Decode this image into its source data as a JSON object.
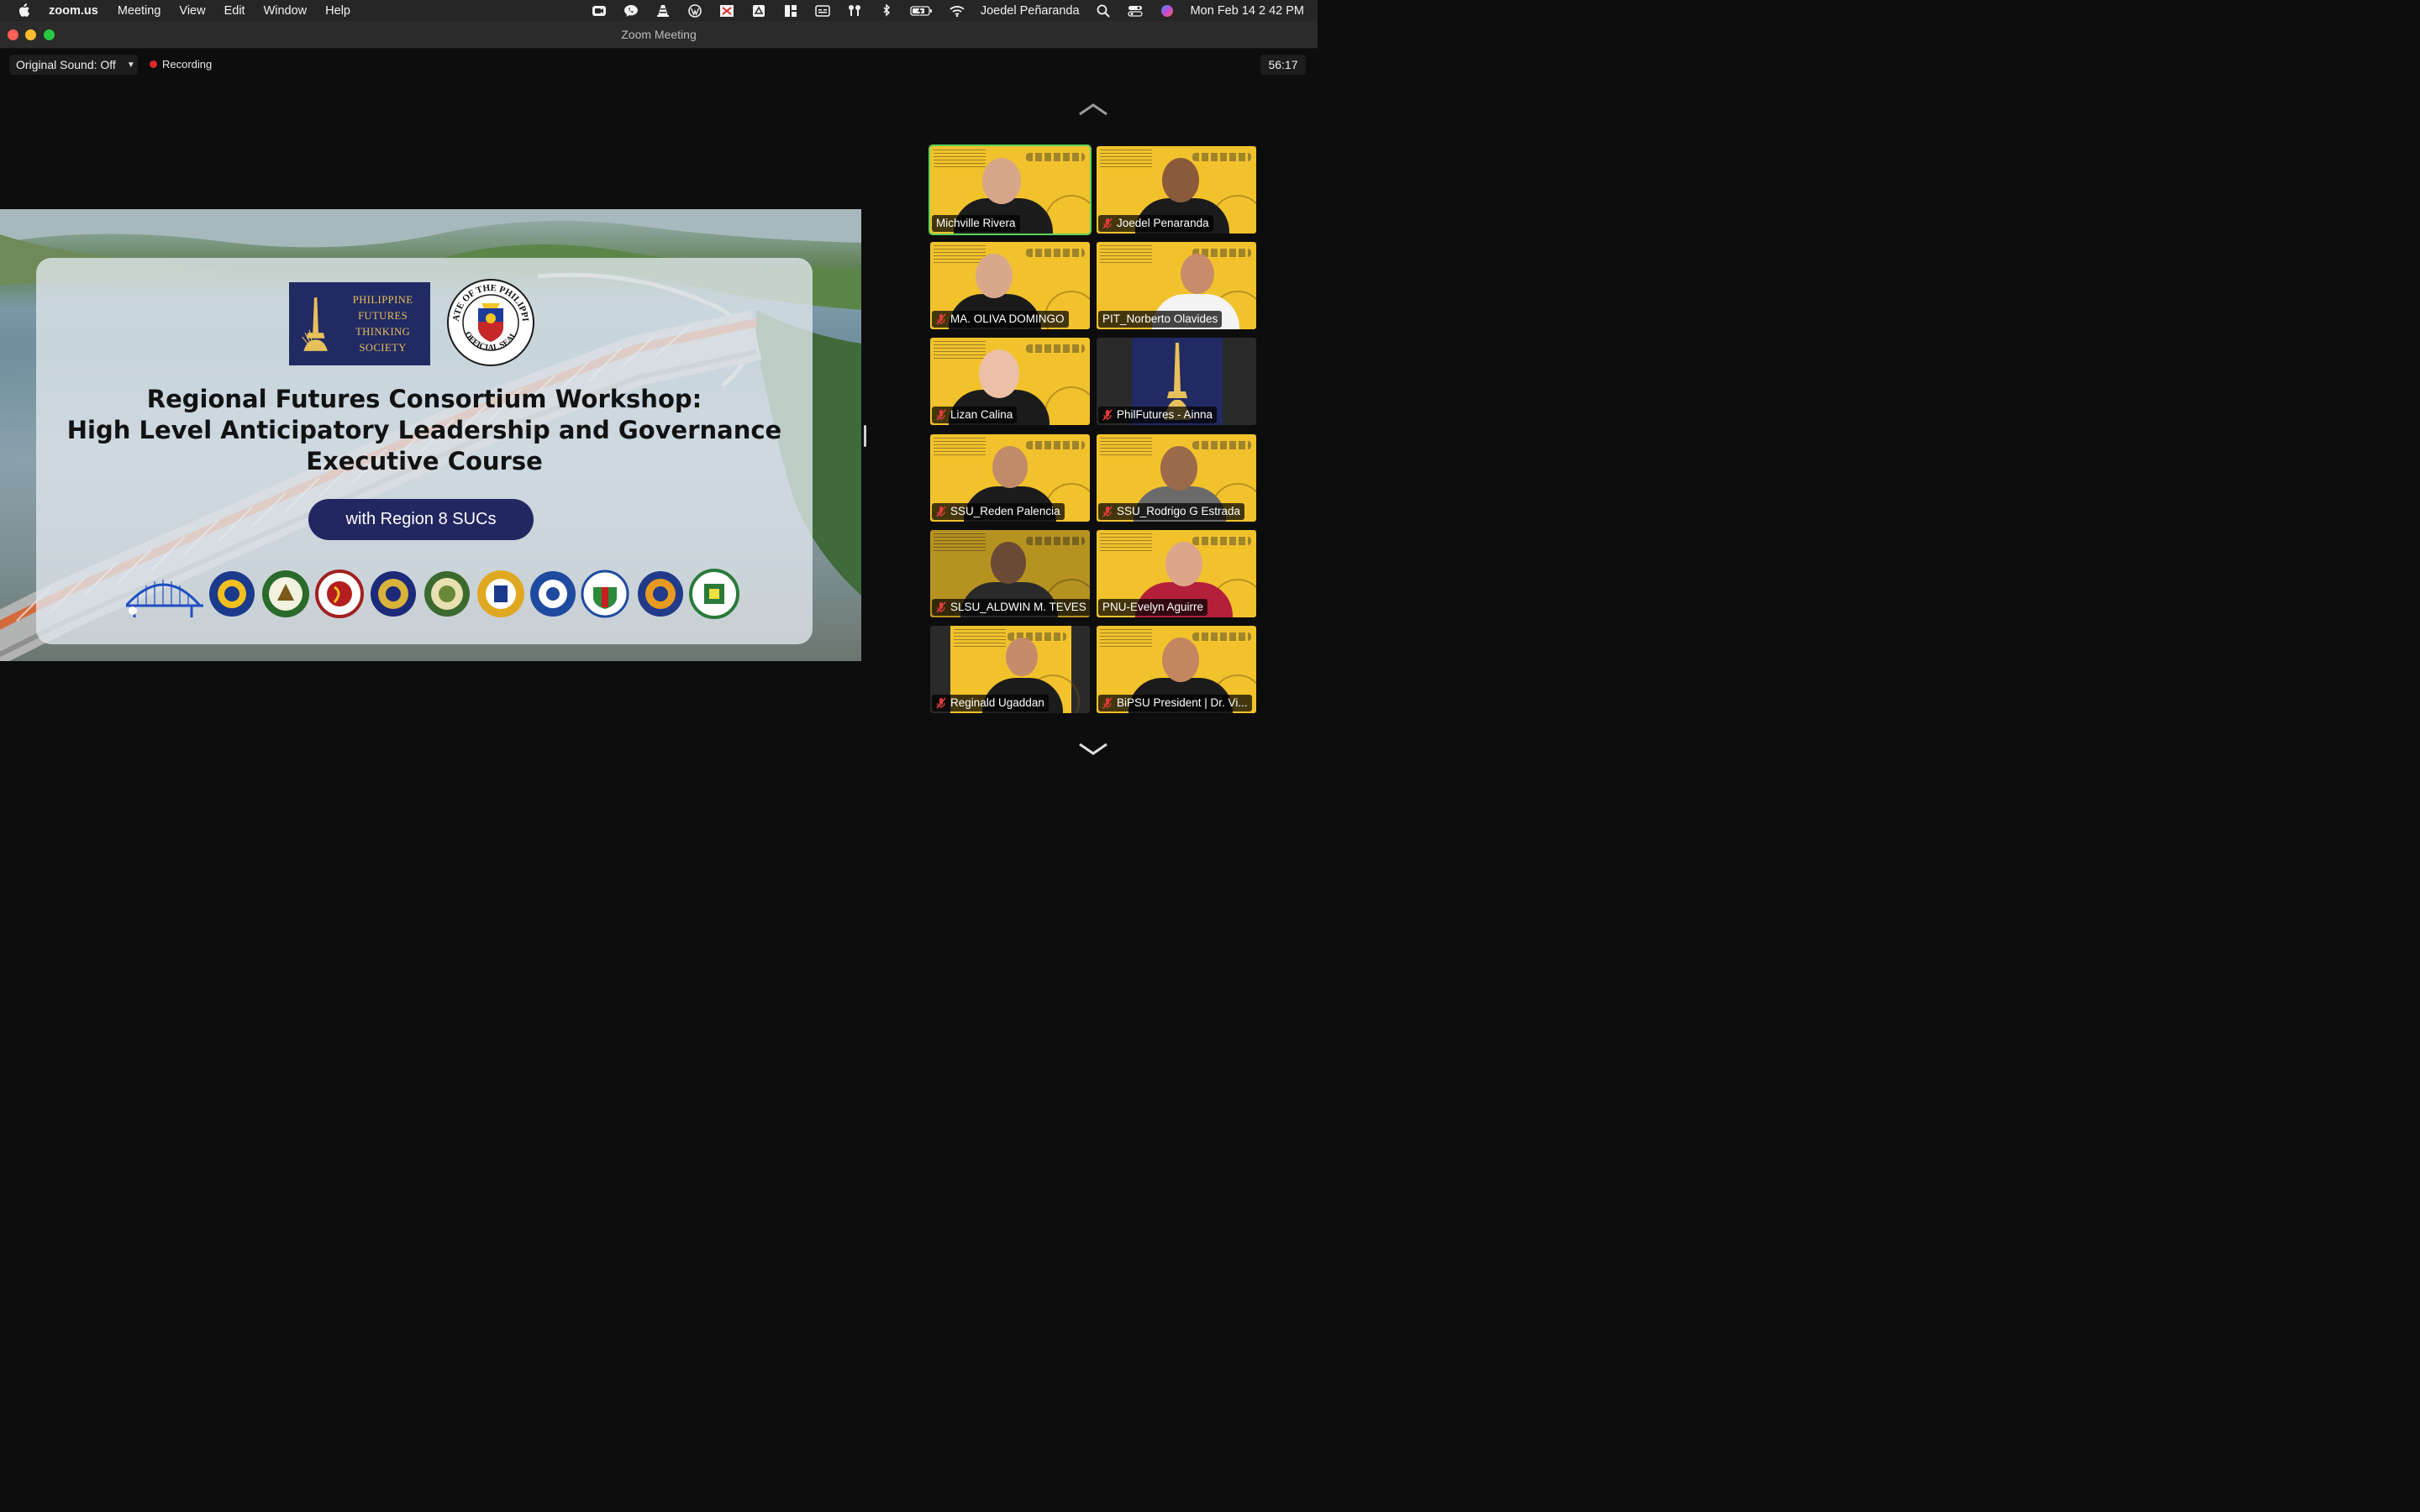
{
  "menubar": {
    "app_name": "zoom.us",
    "menus": [
      "Meeting",
      "View",
      "Edit",
      "Window",
      "Help"
    ],
    "user": "Joedel Peñaranda",
    "clock": "Mon Feb 14  2 42 PM"
  },
  "window": {
    "title": "Zoom Meeting"
  },
  "toolbar": {
    "original_sound": "Original Sound: Off",
    "recording_label": "Recording",
    "timer": "56:17"
  },
  "slide": {
    "logo_text_line1": "PHILIPPINE FUTURES",
    "logo_text_line2": "THINKING SOCIETY",
    "seal_text_top": "SENATE OF THE PHILIPPINES",
    "seal_text_bottom": "OFFICIAL SEAL",
    "title_line1": "Regional Futures Consortium Workshop:",
    "title_line2": "High Level Anticipatory Leadership and Governance",
    "title_line3": "Executive Course",
    "region_pill": "with Region 8 SUCs"
  },
  "participants": [
    {
      "name": "Michville Rivera",
      "muted": false,
      "active_speaker": true
    },
    {
      "name": "Joedel Penaranda",
      "muted": true,
      "active_speaker": false
    },
    {
      "name": "MA. OLIVA DOMINGO",
      "muted": true,
      "active_speaker": false
    },
    {
      "name": "PIT_Norberto Olavides",
      "muted": false,
      "active_speaker": false
    },
    {
      "name": "Lizan Calina",
      "muted": true,
      "active_speaker": false
    },
    {
      "name": "PhilFutures - Ainna",
      "muted": true,
      "active_speaker": false
    },
    {
      "name": "SSU_Reden Palencia",
      "muted": true,
      "active_speaker": false
    },
    {
      "name": "SSU_Rodrigo G Estrada",
      "muted": true,
      "active_speaker": false
    },
    {
      "name": "SLSU_ALDWIN M. TEVES",
      "muted": true,
      "active_speaker": false
    },
    {
      "name": "PNU-Evelyn Aguirre",
      "muted": false,
      "active_speaker": false
    },
    {
      "name": "Reginald Ugaddan",
      "muted": true,
      "active_speaker": false
    },
    {
      "name": "BiPSU President | Dr. Vi...",
      "muted": true,
      "active_speaker": false
    }
  ],
  "colors": {
    "accent_green": "#5fd35a",
    "recording_red": "#e02828",
    "slide_navy": "#232761",
    "tile_yellow": "#f2c22c"
  }
}
